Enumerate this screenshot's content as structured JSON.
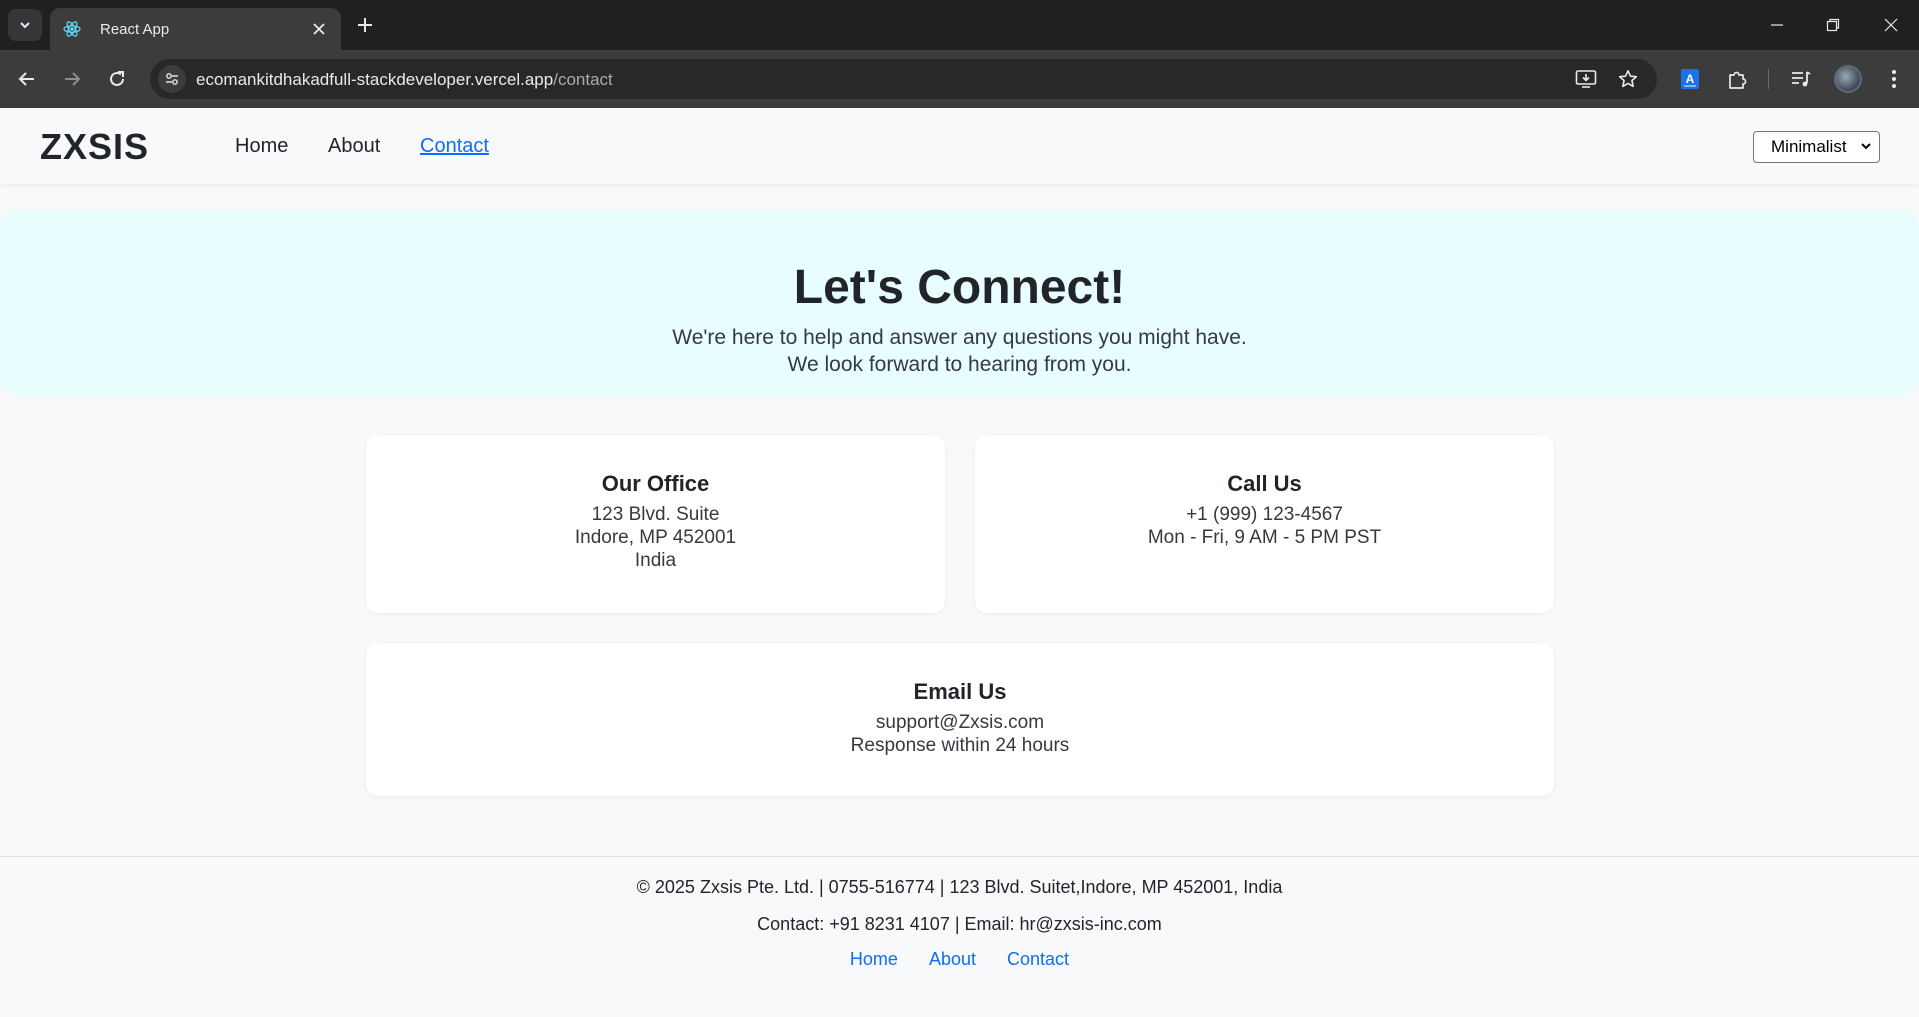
{
  "browser": {
    "tab_title": "React App",
    "url_domain": "ecomankitdhakadfull-stackdeveloper.vercel.app",
    "url_path": "/contact",
    "icons": {
      "tab_search": "chevron-down-icon",
      "favicon": "react-icon",
      "tab_close": "close-icon",
      "new_tab": "plus-icon",
      "minimize": "minimize-icon",
      "restore": "restore-icon",
      "close_window": "close-icon",
      "back": "arrow-left-icon",
      "forward": "arrow-right-icon",
      "reload": "reload-icon",
      "site_info": "tune-icon",
      "install": "install-icon",
      "bookmark": "star-icon",
      "extension_a": "translate-icon",
      "extensions": "puzzle-icon",
      "media": "media-control-icon",
      "profile": "avatar",
      "menu": "kebab-menu-icon"
    }
  },
  "nav": {
    "logo": "ZXSIS",
    "links": [
      "Home",
      "About",
      "Contact"
    ],
    "active_link": "Contact",
    "theme_select": "Minimalist"
  },
  "hero": {
    "title": "Let's Connect!",
    "subtitle_line1": "We're here to help and answer any questions you might have.",
    "subtitle_line2": "We look forward to hearing from you."
  },
  "cards": {
    "office": {
      "title": "Our Office",
      "lines": [
        "123 Blvd. Suite",
        "Indore, MP 452001",
        "India"
      ]
    },
    "call": {
      "title": "Call Us",
      "lines": [
        "+1 (999) 123-4567",
        "Mon - Fri, 9 AM - 5 PM PST"
      ]
    },
    "email": {
      "title": "Email Us",
      "lines": [
        "support@Zxsis.com",
        "Response within 24 hours"
      ]
    }
  },
  "footer": {
    "line1": "© 2025 Zxsis Pte. Ltd. | 0755-516774 | 123 Blvd. Suitet,Indore, MP 452001, India",
    "line2": "Contact: +91 8231 4107 | Email: hr@zxsis-inc.com",
    "links": [
      "Home",
      "About",
      "Contact"
    ]
  },
  "colors": {
    "chrome_dark": "#1f2020",
    "chrome_toolbar": "#3c3c3c",
    "page_bg": "#f8f9fa",
    "hero_bg": "#e8fdfe",
    "link_blue": "#0d6efd",
    "text_dark": "#212529"
  }
}
